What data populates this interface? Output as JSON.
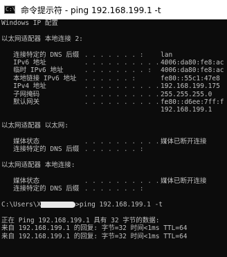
{
  "window": {
    "title": "命令提示符 - ping  192.168.199.1 -t",
    "icon": "cmd-icon"
  },
  "console": {
    "line1": "Windows IP 配置",
    "section1_header": "以太网适配器 本地连接 2:",
    "s1": [
      {
        "label": "   连接特定的 DNS 后缀",
        "dots": " . . . . . . . :",
        "value": "lan"
      },
      {
        "label": "   IPv6 地址",
        "dots": " . . . . . . . . . . :",
        "value": "4006:da80:fe8:ac"
      },
      {
        "label": "   临时 IPv6 地址",
        "dots": " . . . . . . . . :",
        "value": "4006:da80:fe8:ac"
      },
      {
        "label": "   本地链接 IPv6 地址",
        "dots": " . . . . . . :",
        "value": "fe80::55c1:47e8"
      },
      {
        "label": "   IPv4 地址",
        "dots": " . . . . . . . . . . :",
        "value": "192.168.199.175"
      },
      {
        "label": "   子网掩码",
        "dots": " . . . . . . . . . . :",
        "value": "255.255.255.0"
      },
      {
        "label": "   默认网关",
        "dots": " . . . . . . . . . . :",
        "value": "fe80::d6ee:7ff:f"
      }
    ],
    "gateway_extra": "192.168.199.1",
    "section2_header": "以太网适配器 以太网:",
    "s2": [
      {
        "label": "   媒体状态",
        "dots": " . . . . . . . . . . :",
        "value": "媒体已断开连接"
      },
      {
        "label": "   连接特定的 DNS 后缀",
        "dots": " . . . . . . . :",
        "value": ""
      }
    ],
    "section3_header": "以太网适配器 本地连接:",
    "s3": [
      {
        "label": "   媒体状态",
        "dots": " . . . . . . . . . . :",
        "value": "媒体已断开连接"
      },
      {
        "label": "   连接特定的 DNS 后缀",
        "dots": " . . . . . . . :",
        "value": ""
      }
    ],
    "prompt_prefix": "C:\\Users\\X",
    "prompt_cmd": ">ping 192.168.199.1 -t",
    "ping_header": "正在 Ping 192.168.199.1 具有 32 字节的数据:",
    "reply1": "来自 192.168.199.1 的回复: 字节=32 时间<1ms TTL=64",
    "reply2": "来自 192.168.199.1 的回复: 字节=32 时间<1ms TTL=64"
  }
}
